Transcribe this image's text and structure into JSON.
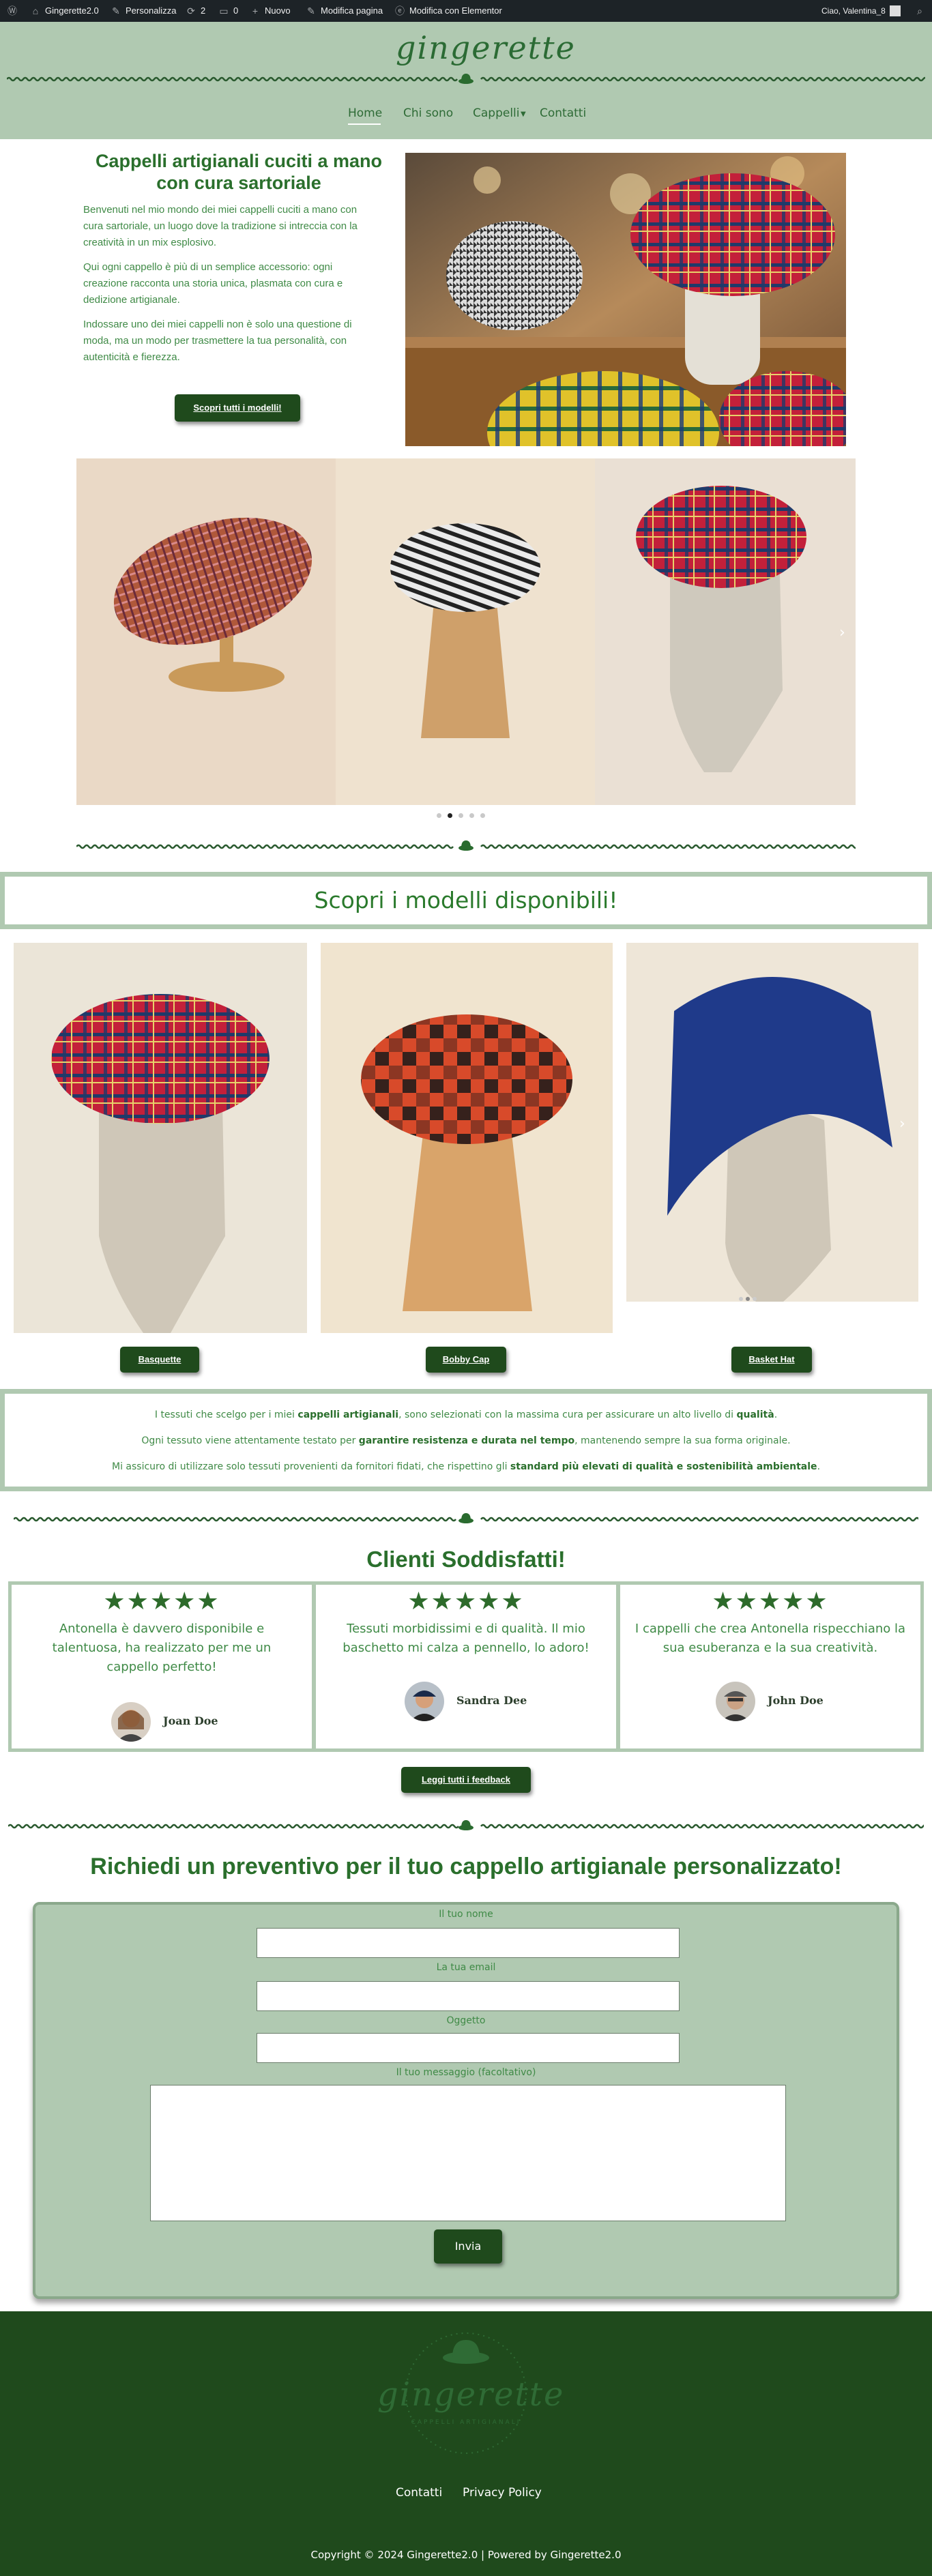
{
  "admin_bar": {
    "site_name": "Gingerette2.0",
    "customize": "Personalizza",
    "updates_count": "2",
    "comments_count": "0",
    "new": "Nuovo",
    "edit_page": "Modifica pagina",
    "edit_elementor": "Modifica con Elementor",
    "greeting": "Ciao, Valentina_8"
  },
  "header": {
    "logo": "gingerette",
    "menu": [
      "Home",
      "Chi sono",
      "Cappelli",
      "Contatti"
    ],
    "active_index": 0
  },
  "hero": {
    "title_line1": "Cappelli artigianali cuciti a mano",
    "title_line2": "con cura sartoriale",
    "paragraphs": [
      [
        "Benvenuti nel mio mondo dei miei cappelli cuciti a mano con",
        "cura sartoriale, un luogo dove la tradizione si intreccia con la",
        "creatività in un mix esplosivo."
      ],
      [
        "Qui ogni cappello è più di un semplice accessorio: ogni",
        "creazione racconta una storia unica, plasmata con cura e",
        "dedizione artigianale."
      ],
      [
        "Indossare uno dei miei cappelli non è solo una questione di",
        "moda, ma un modo per trasmettere la tua personalità, con",
        "autenticità e fierezza."
      ]
    ],
    "button": "Scopri tutti i modelli!"
  },
  "carousel": {
    "slide_count": 5,
    "active_dot": 1,
    "next_icon": "chevron-right-icon"
  },
  "models": {
    "heading": "Scopri i modelli disponibili!",
    "items": [
      {
        "button": "Basquette"
      },
      {
        "button": "Bobby Cap"
      },
      {
        "button": "Basket Hat"
      }
    ]
  },
  "quality": {
    "line1_a": "I tessuti che scelgo per i miei ",
    "line1_b": "cappelli artigianali",
    "line1_c": ", sono selezionati con la massima cura per assicurare un alto livello di ",
    "line1_d": "qualità",
    "line1_e": ".",
    "line2_a": "Ogni tessuto viene attentamente testato per ",
    "line2_b": "garantire resistenza e durata nel tempo",
    "line2_c": ", mantenendo sempre la sua forma originale.",
    "line3_a": "Mi assicuro di utilizzare solo tessuti provenienti da fornitori fidati, che rispettino gli ",
    "line3_b": "standard più elevati di qualità e sostenibilità ambientale",
    "line3_c": "."
  },
  "testimonials": {
    "heading": "Clienti Soddisfatti!",
    "stars": "★★★★★",
    "items": [
      {
        "lines": [
          "Antonella è davvero disponibile e",
          "talentuosa, ha realizzato per me un",
          "cappello perfetto!"
        ],
        "name": "Joan Doe"
      },
      {
        "lines": [
          "Tessuti morbidissimi e di qualità. Il mio",
          "baschetto mi calza a pennello, lo adoro!"
        ],
        "name": "Sandra Dee"
      },
      {
        "lines": [
          "I cappelli che crea Antonella rispecchiano la",
          "sua esuberanza e la sua creatività."
        ],
        "name": "John Doe"
      }
    ],
    "button": "Leggi tutti i feedback"
  },
  "quote_form": {
    "heading": "Richiedi un preventivo per il tuo cappello artigianale personalizzato!",
    "name_label": "Il tuo nome",
    "email_label": "La tua email",
    "subject_label": "Oggetto",
    "message_label": "Il tuo messaggio (facoltativo)",
    "submit": "Invia"
  },
  "footer": {
    "logo": "gingerette",
    "logo_tagline": "CAPPELLI ARTIGIANALI",
    "links": [
      "Contatti",
      "Privacy Policy"
    ],
    "copyright": "Copyright © 2024 Gingerette2.0 | Powered by Gingerette2.0"
  },
  "colors": {
    "sage": "#b0c9b1",
    "dark_green": "#1f4a1c",
    "title_green": "#2a6f2c",
    "text_green": "#3f8a46",
    "admin_bar": "#1d2327"
  }
}
